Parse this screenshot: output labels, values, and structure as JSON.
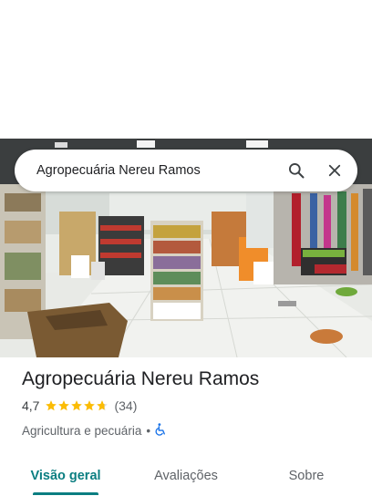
{
  "search": {
    "query": "Agropecuária Nereu Ramos"
  },
  "place": {
    "name": "Agropecuária Nereu Ramos",
    "rating": "4,7",
    "rating_fraction": 0.94,
    "review_count": "(34)",
    "category": "Agricultura e pecuária",
    "separator": "•"
  },
  "tabs": [
    {
      "label": "Visão geral",
      "active": true
    },
    {
      "label": "Avaliações",
      "active": false
    },
    {
      "label": "Sobre",
      "active": false
    }
  ],
  "colors": {
    "accent": "#0b7e81",
    "star": "#fbbc04",
    "accessibility": "#1a73e8"
  },
  "icons": {
    "search": "search-icon",
    "close": "close-icon",
    "accessibility": "wheelchair-icon",
    "star": "star-icon"
  }
}
